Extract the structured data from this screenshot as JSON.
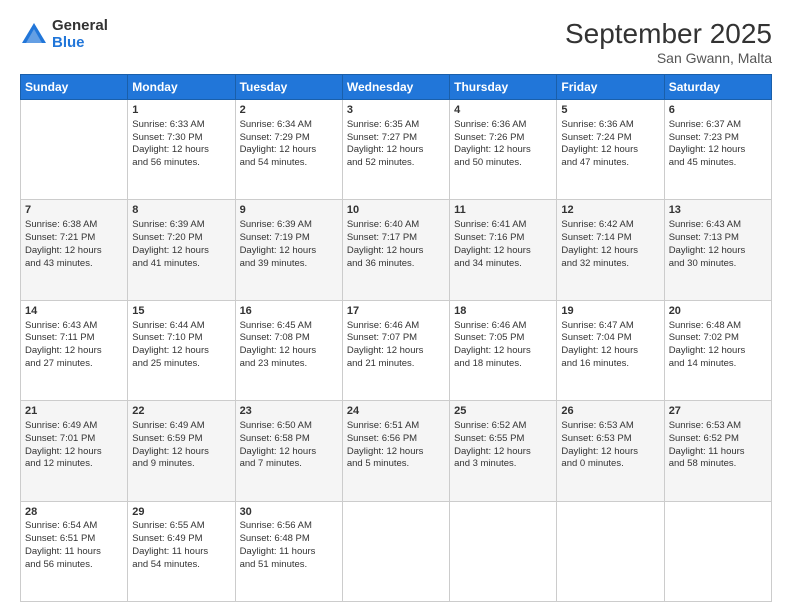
{
  "logo": {
    "general": "General",
    "blue": "Blue"
  },
  "title": "September 2025",
  "subtitle": "San Gwann, Malta",
  "days": [
    "Sunday",
    "Monday",
    "Tuesday",
    "Wednesday",
    "Thursday",
    "Friday",
    "Saturday"
  ],
  "weeks": [
    [
      {
        "day": "",
        "content": ""
      },
      {
        "day": "1",
        "content": "Sunrise: 6:33 AM\nSunset: 7:30 PM\nDaylight: 12 hours\nand 56 minutes."
      },
      {
        "day": "2",
        "content": "Sunrise: 6:34 AM\nSunset: 7:29 PM\nDaylight: 12 hours\nand 54 minutes."
      },
      {
        "day": "3",
        "content": "Sunrise: 6:35 AM\nSunset: 7:27 PM\nDaylight: 12 hours\nand 52 minutes."
      },
      {
        "day": "4",
        "content": "Sunrise: 6:36 AM\nSunset: 7:26 PM\nDaylight: 12 hours\nand 50 minutes."
      },
      {
        "day": "5",
        "content": "Sunrise: 6:36 AM\nSunset: 7:24 PM\nDaylight: 12 hours\nand 47 minutes."
      },
      {
        "day": "6",
        "content": "Sunrise: 6:37 AM\nSunset: 7:23 PM\nDaylight: 12 hours\nand 45 minutes."
      }
    ],
    [
      {
        "day": "7",
        "content": "Sunrise: 6:38 AM\nSunset: 7:21 PM\nDaylight: 12 hours\nand 43 minutes."
      },
      {
        "day": "8",
        "content": "Sunrise: 6:39 AM\nSunset: 7:20 PM\nDaylight: 12 hours\nand 41 minutes."
      },
      {
        "day": "9",
        "content": "Sunrise: 6:39 AM\nSunset: 7:19 PM\nDaylight: 12 hours\nand 39 minutes."
      },
      {
        "day": "10",
        "content": "Sunrise: 6:40 AM\nSunset: 7:17 PM\nDaylight: 12 hours\nand 36 minutes."
      },
      {
        "day": "11",
        "content": "Sunrise: 6:41 AM\nSunset: 7:16 PM\nDaylight: 12 hours\nand 34 minutes."
      },
      {
        "day": "12",
        "content": "Sunrise: 6:42 AM\nSunset: 7:14 PM\nDaylight: 12 hours\nand 32 minutes."
      },
      {
        "day": "13",
        "content": "Sunrise: 6:43 AM\nSunset: 7:13 PM\nDaylight: 12 hours\nand 30 minutes."
      }
    ],
    [
      {
        "day": "14",
        "content": "Sunrise: 6:43 AM\nSunset: 7:11 PM\nDaylight: 12 hours\nand 27 minutes."
      },
      {
        "day": "15",
        "content": "Sunrise: 6:44 AM\nSunset: 7:10 PM\nDaylight: 12 hours\nand 25 minutes."
      },
      {
        "day": "16",
        "content": "Sunrise: 6:45 AM\nSunset: 7:08 PM\nDaylight: 12 hours\nand 23 minutes."
      },
      {
        "day": "17",
        "content": "Sunrise: 6:46 AM\nSunset: 7:07 PM\nDaylight: 12 hours\nand 21 minutes."
      },
      {
        "day": "18",
        "content": "Sunrise: 6:46 AM\nSunset: 7:05 PM\nDaylight: 12 hours\nand 18 minutes."
      },
      {
        "day": "19",
        "content": "Sunrise: 6:47 AM\nSunset: 7:04 PM\nDaylight: 12 hours\nand 16 minutes."
      },
      {
        "day": "20",
        "content": "Sunrise: 6:48 AM\nSunset: 7:02 PM\nDaylight: 12 hours\nand 14 minutes."
      }
    ],
    [
      {
        "day": "21",
        "content": "Sunrise: 6:49 AM\nSunset: 7:01 PM\nDaylight: 12 hours\nand 12 minutes."
      },
      {
        "day": "22",
        "content": "Sunrise: 6:49 AM\nSunset: 6:59 PM\nDaylight: 12 hours\nand 9 minutes."
      },
      {
        "day": "23",
        "content": "Sunrise: 6:50 AM\nSunset: 6:58 PM\nDaylight: 12 hours\nand 7 minutes."
      },
      {
        "day": "24",
        "content": "Sunrise: 6:51 AM\nSunset: 6:56 PM\nDaylight: 12 hours\nand 5 minutes."
      },
      {
        "day": "25",
        "content": "Sunrise: 6:52 AM\nSunset: 6:55 PM\nDaylight: 12 hours\nand 3 minutes."
      },
      {
        "day": "26",
        "content": "Sunrise: 6:53 AM\nSunset: 6:53 PM\nDaylight: 12 hours\nand 0 minutes."
      },
      {
        "day": "27",
        "content": "Sunrise: 6:53 AM\nSunset: 6:52 PM\nDaylight: 11 hours\nand 58 minutes."
      }
    ],
    [
      {
        "day": "28",
        "content": "Sunrise: 6:54 AM\nSunset: 6:51 PM\nDaylight: 11 hours\nand 56 minutes."
      },
      {
        "day": "29",
        "content": "Sunrise: 6:55 AM\nSunset: 6:49 PM\nDaylight: 11 hours\nand 54 minutes."
      },
      {
        "day": "30",
        "content": "Sunrise: 6:56 AM\nSunset: 6:48 PM\nDaylight: 11 hours\nand 51 minutes."
      },
      {
        "day": "",
        "content": ""
      },
      {
        "day": "",
        "content": ""
      },
      {
        "day": "",
        "content": ""
      },
      {
        "day": "",
        "content": ""
      }
    ]
  ]
}
